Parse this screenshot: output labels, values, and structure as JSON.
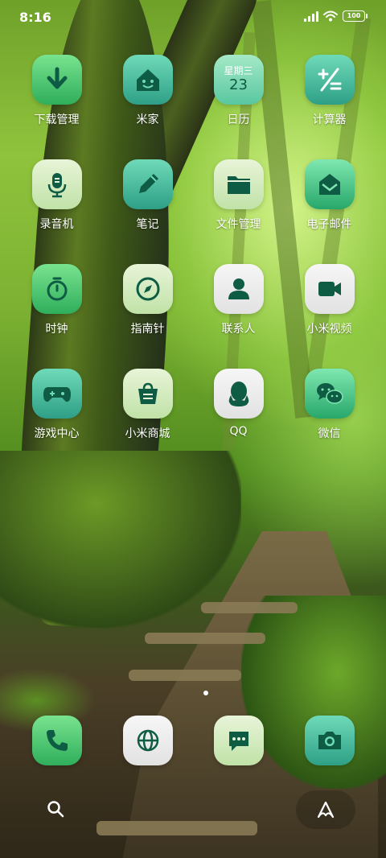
{
  "status_bar": {
    "time": "8:16",
    "battery": "100"
  },
  "apps": [
    {
      "label": "下载管理",
      "icon": "download-icon"
    },
    {
      "label": "米家",
      "icon": "home-face-icon"
    },
    {
      "label": "日历",
      "icon": "calendar-icon",
      "weekday": "星期三",
      "date": "23"
    },
    {
      "label": "计算器",
      "icon": "calculator-icon"
    },
    {
      "label": "录音机",
      "icon": "microphone-icon"
    },
    {
      "label": "笔记",
      "icon": "pencil-icon"
    },
    {
      "label": "文件管理",
      "icon": "folder-icon"
    },
    {
      "label": "电子邮件",
      "icon": "mail-icon"
    },
    {
      "label": "时钟",
      "icon": "stopwatch-icon"
    },
    {
      "label": "指南针",
      "icon": "compass-icon"
    },
    {
      "label": "联系人",
      "icon": "person-icon"
    },
    {
      "label": "小米视频",
      "icon": "video-camera-icon"
    },
    {
      "label": "游戏中心",
      "icon": "gamepad-icon"
    },
    {
      "label": "小米商城",
      "icon": "shopping-bag-icon"
    },
    {
      "label": "QQ",
      "icon": "penguin-icon"
    },
    {
      "label": "微信",
      "icon": "wechat-icon"
    }
  ],
  "dock": [
    {
      "name": "phone",
      "icon": "phone-icon"
    },
    {
      "name": "browser",
      "icon": "globe-icon"
    },
    {
      "name": "messages",
      "icon": "chat-bubble-icon"
    },
    {
      "name": "camera",
      "icon": "camera-icon"
    }
  ],
  "bottom_bar": {
    "left": "search-icon",
    "right": "assistant-icon"
  },
  "page_indicator": {
    "pages": 1,
    "current": 1
  },
  "colors": {
    "icon_glyph": "#0f5c44",
    "label_text": "#ffffff"
  }
}
